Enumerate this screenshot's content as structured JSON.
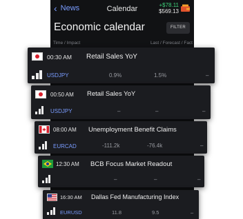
{
  "nav": {
    "back_label": "News",
    "title": "Calendar",
    "balance_change": "+$78.11",
    "balance_value": "$569.13"
  },
  "header": {
    "title": "Economic calendar",
    "filter_label": "FILTER",
    "col_left": "Time / Impact",
    "col_right": "Last / Forecast / Fact"
  },
  "events": [
    {
      "time": "00:30 AM",
      "title": "Retail Sales YoY",
      "pair": "USDJPY",
      "last": "0.9%",
      "forecast": "1.5%",
      "fact": "–",
      "flag": "japan-flag-icon"
    },
    {
      "time": "00:50 AM",
      "title": "Retail Sales YoY",
      "pair": "USDJPY",
      "last": "–",
      "forecast": "–",
      "fact": "–",
      "flag": "japan-flag-icon"
    },
    {
      "time": "08:00 AM",
      "title": "Unemployment Benefit Claims",
      "pair": "EURCAD",
      "last": "-111.2k",
      "forecast": "-76.4k",
      "fact": "–",
      "flag": "canada-flag-icon"
    },
    {
      "time": "12:30 AM",
      "title": "BCB Focus Market Readout",
      "pair": "",
      "last": "–",
      "forecast": "–",
      "fact": "–",
      "flag": "brazil-flag-icon"
    },
    {
      "time": "16:30 AM",
      "title": "Dallas Fed Manufacturing Index",
      "pair": "EURUSD",
      "last": "11.8",
      "forecast": "9.5",
      "fact": "–",
      "flag": "usa-flag-icon"
    }
  ],
  "colors": {
    "background": "#111214",
    "card": "#1b1c20",
    "accent_blue": "#7a9cff",
    "positive_green": "#3fd07a"
  }
}
